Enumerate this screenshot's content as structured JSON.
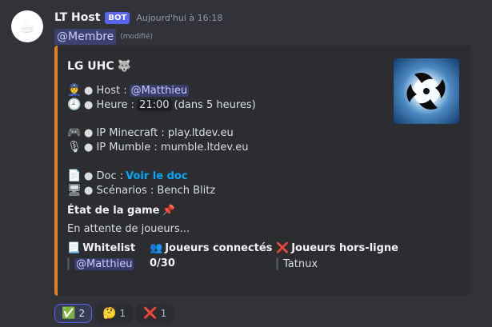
{
  "message": {
    "author": "LT Host",
    "bot_tag": "BOT",
    "timestamp": "Aujourd'hui à 16:18",
    "mention": "@Membre",
    "edited": "(modifié)",
    "avatar_icon": "☕"
  },
  "embed": {
    "accent_color": "#e67e22",
    "title": "LG UHC",
    "title_emoji": "🐺",
    "lines": {
      "host_label": "● Host :",
      "host_mention": "@Matthieu",
      "heure_label": "● Heure :",
      "heure_time": "21:00",
      "heure_rel": "(dans 5 heures)",
      "ip_mc": "● IP Minecraft : play.ltdev.eu",
      "ip_mumble": "● IP Mumble : mumble.ltdev.eu",
      "doc_label": "● Doc :",
      "doc_link": "Voir le doc",
      "scenarios": "● Scénarios : Bench Blitz"
    },
    "emojis": {
      "host": "👮",
      "heure": "🕘",
      "mc": "🎮",
      "mumble": "🎙",
      "doc": "📄",
      "scen": "🖥"
    },
    "state_title": "État de la game",
    "state_emoji": "📌",
    "state_text": "En attente de joueurs...",
    "fields": [
      {
        "icon": "📃",
        "name": "Whitelist",
        "value": "@Matthieu"
      },
      {
        "icon": "👥",
        "name": "Joueurs connectés",
        "value": "0/30"
      },
      {
        "icon": "❌",
        "name": "Joueurs hors-ligne",
        "value": "Tatnux"
      }
    ]
  },
  "reactions": [
    {
      "emoji": "✅",
      "count": "2"
    },
    {
      "emoji": "🤔",
      "count": "1"
    },
    {
      "emoji": "❌",
      "count": "1"
    }
  ]
}
